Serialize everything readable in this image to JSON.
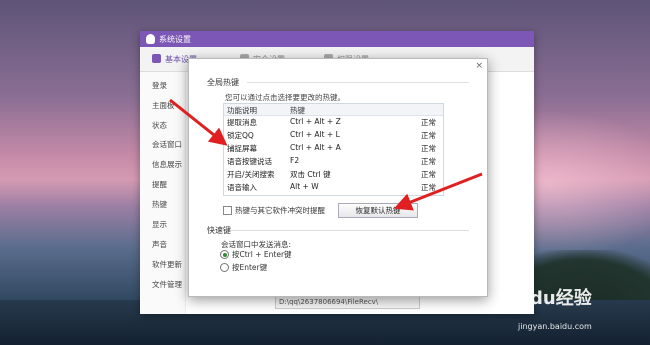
{
  "window": {
    "title": "系统设置",
    "tabs": [
      {
        "label": "基本设置",
        "active": true,
        "icon": "gear-icon"
      },
      {
        "label": "安全设置",
        "active": false,
        "icon": "shield-icon"
      },
      {
        "label": "权限设置",
        "active": false,
        "icon": "lock-icon"
      }
    ],
    "sidebar": [
      "登录",
      "主面板",
      "状态",
      "会话窗口",
      "信息展示",
      "提醒",
      "热键",
      "显示",
      "声音",
      "软件更新",
      "文件管理"
    ],
    "file_path": "D:\\qq\\2637806694\\FileRecv\\"
  },
  "dialog": {
    "close": "×",
    "global_hotkey_title": "全局热键",
    "hint": "您可以通过点击选择要更改的热键。",
    "table": {
      "columns": [
        "功能说明",
        "热键",
        ""
      ],
      "rows": [
        [
          "提取消息",
          "Ctrl + Alt + Z",
          "正常"
        ],
        [
          "锁定QQ",
          "Ctrl + Alt + L",
          "正常"
        ],
        [
          "捕捉屏幕",
          "Ctrl + Alt + A",
          "正常"
        ],
        [
          "语音按键说话",
          "F2",
          "正常"
        ],
        [
          "开启/关闭搜索",
          "双击 Ctrl 键",
          "正常"
        ],
        [
          "语音输入",
          "Alt + W",
          "正常"
        ]
      ]
    },
    "conflict_checkbox": "热键与其它软件冲突时提醒",
    "restore_button": "恢复默认热键",
    "quick_key_title": "快速键",
    "send_label": "会话窗口中发送消息:",
    "send_options": [
      {
        "label": "按Ctrl + Enter键",
        "selected": true
      },
      {
        "label": "按Enter键",
        "selected": false
      }
    ]
  },
  "watermark": {
    "main": "Baidu经验",
    "url": "jingyan.baidu.com"
  },
  "colors": {
    "titlebar": "#7c57b5",
    "arrow": "#e02020",
    "radio_on": "#3b8a3b"
  }
}
